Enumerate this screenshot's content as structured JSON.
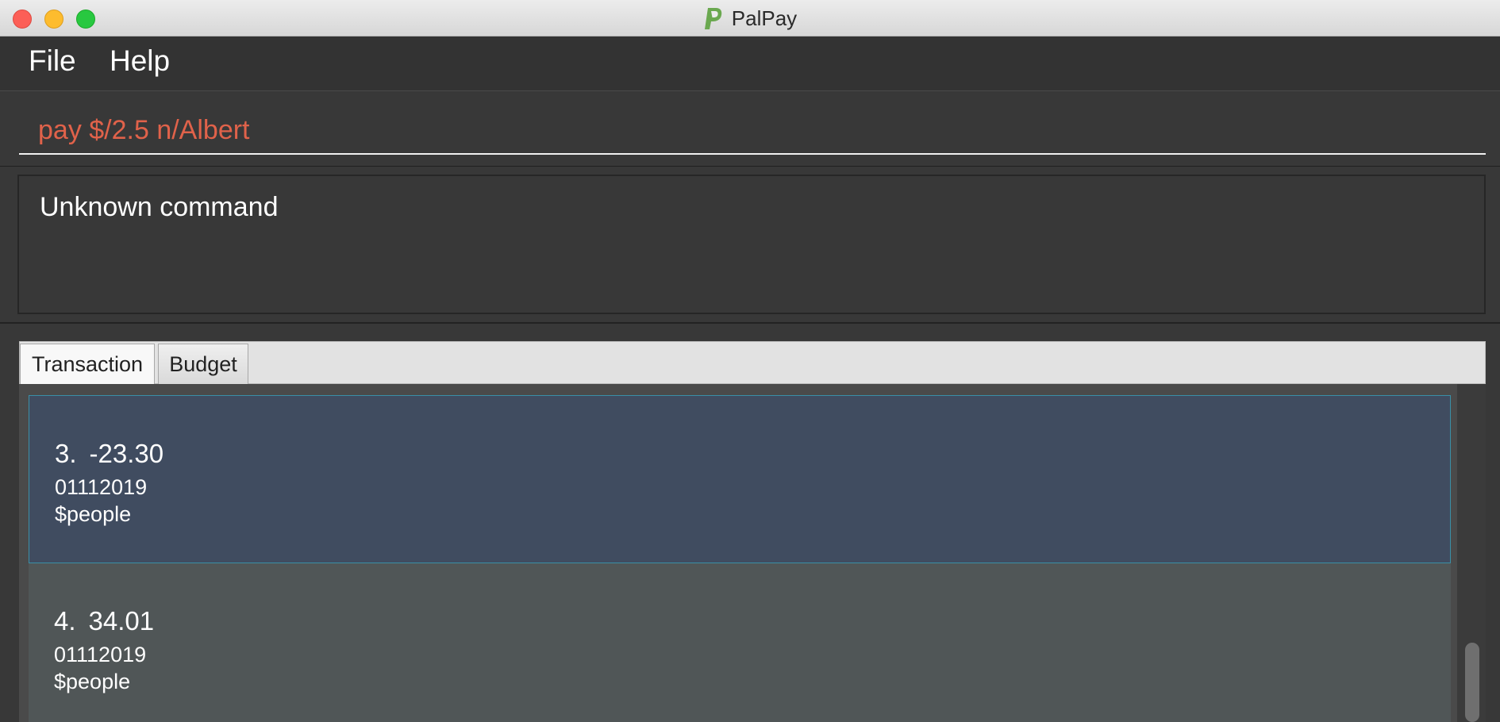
{
  "window": {
    "title": "PalPay",
    "app_icon": "paypal-logo-icon"
  },
  "menu": {
    "items": [
      {
        "label": "File"
      },
      {
        "label": "Help"
      }
    ]
  },
  "command": {
    "value": "pay $/2.5 n/Albert",
    "text_color": "#e0624a"
  },
  "result": {
    "message": "Unknown command"
  },
  "tabs": [
    {
      "label": "Transaction",
      "active": true
    },
    {
      "label": "Budget",
      "active": false
    }
  ],
  "transactions": [
    {
      "index": "3.",
      "amount": "-23.30",
      "date": "01112019",
      "tag": "$people",
      "selected": true
    },
    {
      "index": "4.",
      "amount": "34.01",
      "date": "01112019",
      "tag": "$people",
      "selected": false
    }
  ],
  "colors": {
    "selected_row": "#404c60",
    "normal_row": "#505657",
    "selected_border": "#3a8fa6"
  }
}
